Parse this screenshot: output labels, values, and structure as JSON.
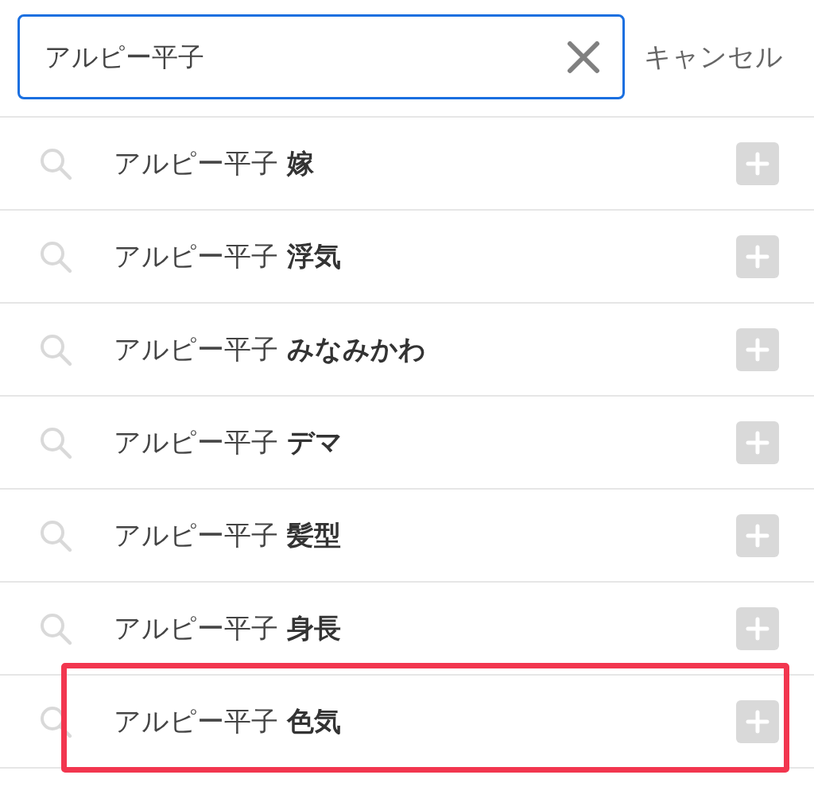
{
  "search": {
    "value": "アルピー平子",
    "focused": true
  },
  "cancel_button": {
    "label": "キャンセル"
  },
  "suggestions": [
    {
      "text": "アルピー平子 **嫁**",
      "highlighted": false
    },
    {
      "text": "アルピー平子 **浮気**",
      "highlighted": false
    },
    {
      "text": "アルピー平子 **みなみかわ**",
      "highlighted": false
    },
    {
      "text": "アルピー平子 **デマ**",
      "highlighted": false
    },
    {
      "text": "アルピー平子 **髪型**",
      "highlighted": false
    },
    {
      "text": "アルピー平子 **身長**",
      "highlighted": false
    },
    {
      "text": "アルピー平子 **色気**",
      "highlighted": true
    }
  ]
}
